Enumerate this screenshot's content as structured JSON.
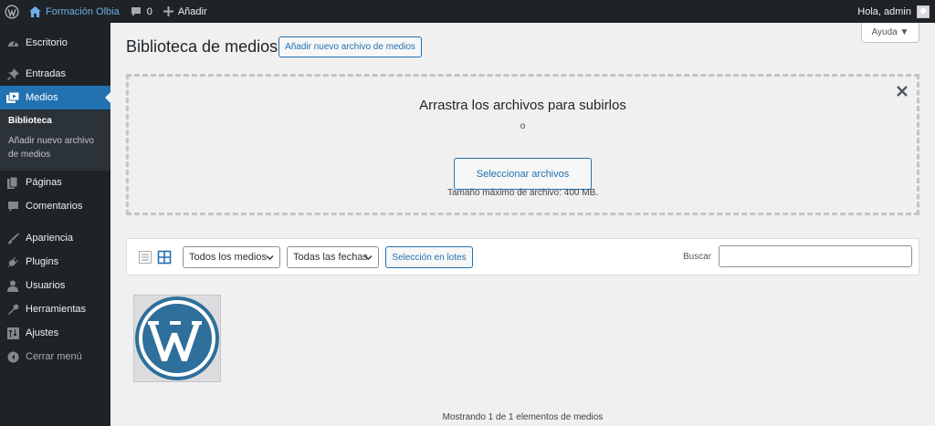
{
  "adminbar": {
    "site_name": "Formación Olbia",
    "comments_count": "0",
    "new_label": "Añadir",
    "greeting": "Hola, admin"
  },
  "sidebar": {
    "items": [
      {
        "label": "Escritorio",
        "icon": "dashboard-icon"
      },
      {
        "label": "Entradas",
        "icon": "pin-icon"
      },
      {
        "label": "Medios",
        "icon": "media-icon",
        "active": true
      },
      {
        "label": "Páginas",
        "icon": "page-icon"
      },
      {
        "label": "Comentarios",
        "icon": "comment-icon"
      },
      {
        "label": "Apariencia",
        "icon": "brush-icon"
      },
      {
        "label": "Plugins",
        "icon": "plug-icon"
      },
      {
        "label": "Usuarios",
        "icon": "user-icon"
      },
      {
        "label": "Herramientas",
        "icon": "wrench-icon"
      },
      {
        "label": "Ajustes",
        "icon": "settings-icon"
      }
    ],
    "submenu": {
      "library": "Biblioteca",
      "add_new": "Añadir nuevo archivo de medios"
    },
    "collapse_label": "Cerrar menú"
  },
  "main": {
    "title": "Biblioteca de medios",
    "add_new_button": "Añadir nuevo archivo de medios",
    "help_label": "Ayuda ▼",
    "uploader": {
      "title": "Arrastra los archivos para subirlos",
      "or": "o",
      "select_button": "Seleccionar archivos",
      "max_size": "Tamaño máximo de archivo: 400 MB."
    },
    "toolbar": {
      "filter_type": "Todos los medios",
      "filter_date": "Todas las fechas",
      "bulk_select": "Selección en lotes",
      "search_label": "Buscar",
      "search_value": ""
    },
    "count_text": "Mostrando 1 de 1 elementos de medios"
  },
  "colors": {
    "admin_dark": "#1d2327",
    "accent": "#2271b1",
    "link": "#72aee6",
    "background": "#f0f0f1"
  }
}
